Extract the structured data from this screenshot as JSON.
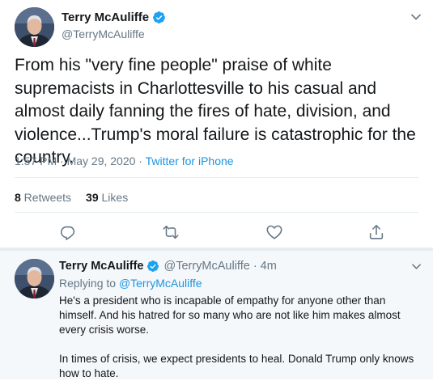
{
  "tweet": {
    "author": {
      "name": "Terry McAuliffe",
      "handle": "@TerryMcAuliffe",
      "verified": true
    },
    "text": "From his \"very fine people\" praise of white supremacists in Charlottesville to his casual and almost daily fanning the fires of hate, division, and violence...Trump's moral failure is catastrophic for the country.",
    "time": "1:57 PM · May 29, 2020",
    "separator": " · ",
    "source": "Twitter for iPhone",
    "retweets_count": "8",
    "retweets_label": " Retweets",
    "likes_count": "39",
    "likes_label": " Likes"
  },
  "actions": [
    "reply-icon",
    "retweet-icon",
    "like-icon",
    "share-icon"
  ],
  "reply": {
    "author_name": "Terry McAuliffe",
    "author_handle": "@TerryMcAuliffe",
    "time_ago": "· 4m",
    "replying_prefix": "Replying to ",
    "replying_to": "@TerryMcAuliffe",
    "text": "He's a president who is incapable of empathy for anyone other than himself. And his hatred for so many who are not like him makes almost every crisis worse.\n\nIn times of crisis, we expect presidents to heal. Donald Trump only knows how to hate."
  },
  "colors": {
    "link": "#1b95e0",
    "muted": "#657786",
    "text": "#14171a",
    "verified": "#1da1f2",
    "divider": "#e6ecf0",
    "reply_bg": "#f5f8fa"
  }
}
